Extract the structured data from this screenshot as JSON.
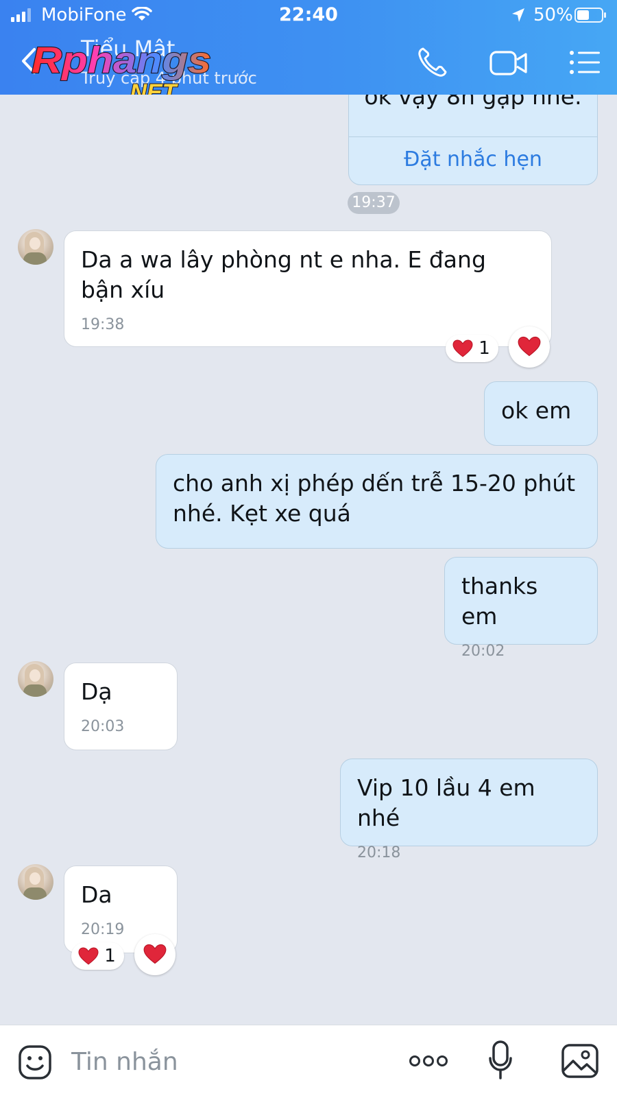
{
  "status_bar": {
    "carrier": "MobiFone",
    "time": "22:40",
    "battery": "50%",
    "battery_level": 0.5
  },
  "header": {
    "contact_name": "Tiểu Mật",
    "contact_status": "Truy cập 4 phút trước",
    "watermark_main": "Rphangs",
    "watermark_sub": ".NET"
  },
  "colors": {
    "header_gradient_start": "#3a82f0",
    "header_gradient_end": "#46a7f4",
    "incoming_bubble": "#ffffff",
    "outgoing_bubble": "#d7ebfb",
    "chat_background": "#e3e7ef",
    "link": "#2c7be0",
    "heart": "#e0263a"
  },
  "messages": [
    {
      "direction": "out",
      "text": "ok vậy 8h gặp nhé.",
      "action": "Đặt nhắc hẹn"
    },
    {
      "separator_time": "19:37"
    },
    {
      "direction": "in",
      "text": "Da a wa lây phòng nt e nha. E đang bận xíu",
      "time": "19:38",
      "reaction": {
        "icon": "heart-icon",
        "count": "1"
      }
    },
    {
      "direction": "out",
      "text": "ok em"
    },
    {
      "direction": "out",
      "text": "cho anh xị phép dến trễ 15-20 phút nhé. Kẹt xe quá"
    },
    {
      "direction": "out",
      "text": "thanks em",
      "time": "20:02"
    },
    {
      "direction": "in",
      "text": "Dạ",
      "time": "20:03"
    },
    {
      "direction": "out",
      "text": "Vip 10 lầu 4 em nhé",
      "time": "20:18"
    },
    {
      "direction": "in",
      "text": "Da",
      "time": "20:19",
      "reaction": {
        "icon": "heart-icon",
        "count": "1"
      }
    }
  ],
  "input": {
    "placeholder": "Tin nhắn"
  }
}
